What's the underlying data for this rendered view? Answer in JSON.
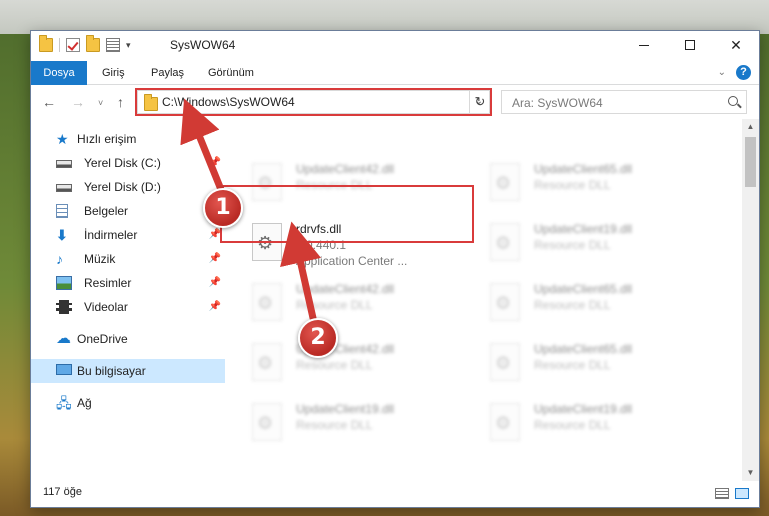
{
  "window": {
    "title": "SysWOW64"
  },
  "ribbon": {
    "tabs": [
      {
        "label": "Dosya"
      },
      {
        "label": "Giriş"
      },
      {
        "label": "Paylaş"
      },
      {
        "label": "Görünüm"
      }
    ],
    "help_label": "?"
  },
  "navigation": {
    "back": "←",
    "forward": "→",
    "recent": "˅",
    "up": "↑",
    "address_path": "C:\\Windows\\SysWOW64",
    "refresh": "↻",
    "search_placeholder": "Ara: SysWOW64"
  },
  "sidebar": {
    "items": [
      {
        "label": "Hızlı erişim",
        "icon": "star-icon"
      },
      {
        "label": "Yerel Disk (C:)",
        "icon": "drive-icon",
        "pinned": true
      },
      {
        "label": "Yerel Disk (D:)",
        "icon": "drive-icon"
      },
      {
        "label": "Belgeler",
        "icon": "documents-icon",
        "pinned": true
      },
      {
        "label": "İndirmeler",
        "icon": "downloads-icon",
        "pinned": true
      },
      {
        "label": "Müzik",
        "icon": "music-icon",
        "pinned": true
      },
      {
        "label": "Resimler",
        "icon": "pictures-icon",
        "pinned": true
      },
      {
        "label": "Videolar",
        "icon": "videos-icon",
        "pinned": true
      },
      {
        "label": "OneDrive",
        "icon": "cloud-icon"
      },
      {
        "label": "Bu bilgisayar",
        "icon": "computer-icon",
        "selected": true
      },
      {
        "label": "Ağ",
        "icon": "network-icon"
      }
    ]
  },
  "files": [
    {
      "name": "UpdateClient42.dll",
      "desc": "Resource DLL"
    },
    {
      "name": "UpdateClient65.dll",
      "desc": "Resource DLL"
    },
    {
      "name": "rdrvfs.dll",
      "version": "1.0.440.1",
      "desc": "Application Center ..."
    },
    {
      "name": "UpdateClient19.dll",
      "desc": "Resource DLL"
    },
    {
      "name": "UpdateClient42.dll",
      "desc": "Resource DLL"
    },
    {
      "name": "UpdateClient65.dll",
      "desc": "Resource DLL"
    },
    {
      "name": "UpdateClient42.dll",
      "desc": "Resource DLL"
    },
    {
      "name": "UpdateClient65.dll",
      "desc": "Resource DLL"
    },
    {
      "name": "UpdateClient19.dll",
      "desc": "Resource DLL"
    },
    {
      "name": "UpdateClient19.dll",
      "desc": "Resource DLL"
    }
  ],
  "status": {
    "item_count": "117 öğe"
  },
  "callouts": [
    {
      "number": "1"
    },
    {
      "number": "2"
    }
  ],
  "colors": {
    "accent": "#1979ca",
    "highlight": "#d93b3b",
    "selection": "#cce8ff"
  }
}
